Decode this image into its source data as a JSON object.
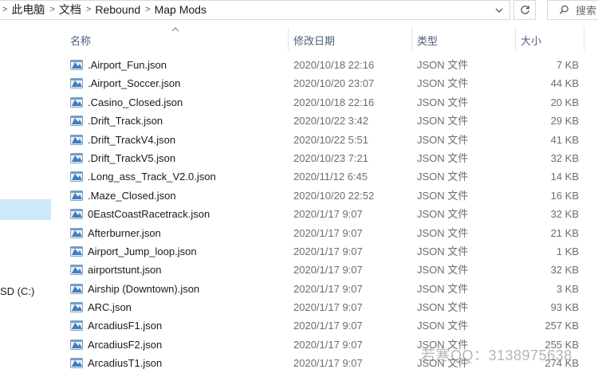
{
  "address_bar": {
    "breadcrumbs": [
      "此电脑",
      "文档",
      "Rebound",
      "Map Mods"
    ],
    "search_placeholder": "搜索"
  },
  "navigation": {
    "drive_label": "SD (C:)"
  },
  "columns": {
    "name": "名称",
    "modified": "修改日期",
    "type": "类型",
    "size": "大小"
  },
  "files": [
    {
      "name": ".Airport_Fun.json",
      "modified": "2020/10/18 22:16",
      "type": "JSON 文件",
      "size": "7 KB"
    },
    {
      "name": ".Airport_Soccer.json",
      "modified": "2020/10/20 23:07",
      "type": "JSON 文件",
      "size": "44 KB"
    },
    {
      "name": ".Casino_Closed.json",
      "modified": "2020/10/18 22:16",
      "type": "JSON 文件",
      "size": "20 KB"
    },
    {
      "name": ".Drift_Track.json",
      "modified": "2020/10/22 3:42",
      "type": "JSON 文件",
      "size": "29 KB"
    },
    {
      "name": ".Drift_TrackV4.json",
      "modified": "2020/10/22 5:51",
      "type": "JSON 文件",
      "size": "41 KB"
    },
    {
      "name": ".Drift_TrackV5.json",
      "modified": "2020/10/23 7:21",
      "type": "JSON 文件",
      "size": "32 KB"
    },
    {
      "name": ".Long_ass_Track_V2.0.json",
      "modified": "2020/11/12 6:45",
      "type": "JSON 文件",
      "size": "14 KB"
    },
    {
      "name": ".Maze_Closed.json",
      "modified": "2020/10/20 22:52",
      "type": "JSON 文件",
      "size": "16 KB"
    },
    {
      "name": "0EastCoastRacetrack.json",
      "modified": "2020/1/17 9:07",
      "type": "JSON 文件",
      "size": "32 KB"
    },
    {
      "name": "Afterburner.json",
      "modified": "2020/1/17 9:07",
      "type": "JSON 文件",
      "size": "21 KB"
    },
    {
      "name": "Airport_Jump_loop.json",
      "modified": "2020/1/17 9:07",
      "type": "JSON 文件",
      "size": "1 KB"
    },
    {
      "name": "airportstunt.json",
      "modified": "2020/1/17 9:07",
      "type": "JSON 文件",
      "size": "32 KB"
    },
    {
      "name": "Airship (Downtown).json",
      "modified": "2020/1/17 9:07",
      "type": "JSON 文件",
      "size": "3 KB"
    },
    {
      "name": "ARC.json",
      "modified": "2020/1/17 9:07",
      "type": "JSON 文件",
      "size": "93 KB"
    },
    {
      "name": "ArcadiusF1.json",
      "modified": "2020/1/17 9:07",
      "type": "JSON 文件",
      "size": "257 KB"
    },
    {
      "name": "ArcadiusF2.json",
      "modified": "2020/1/17 9:07",
      "type": "JSON 文件",
      "size": "255 KB"
    },
    {
      "name": "ArcadiusT1.json",
      "modified": "2020/1/17 9:07",
      "type": "JSON 文件",
      "size": "274 KB"
    }
  ],
  "watermark": "若寒QQ：3138975638",
  "colors": {
    "selection": "#cde8fb",
    "header_text": "#4c607a",
    "secondary_text": "#6d6d6d"
  },
  "icons": {
    "file": "json-file-icon",
    "refresh": "refresh-icon",
    "search": "search-icon",
    "dropdown": "chevron-down-icon"
  }
}
